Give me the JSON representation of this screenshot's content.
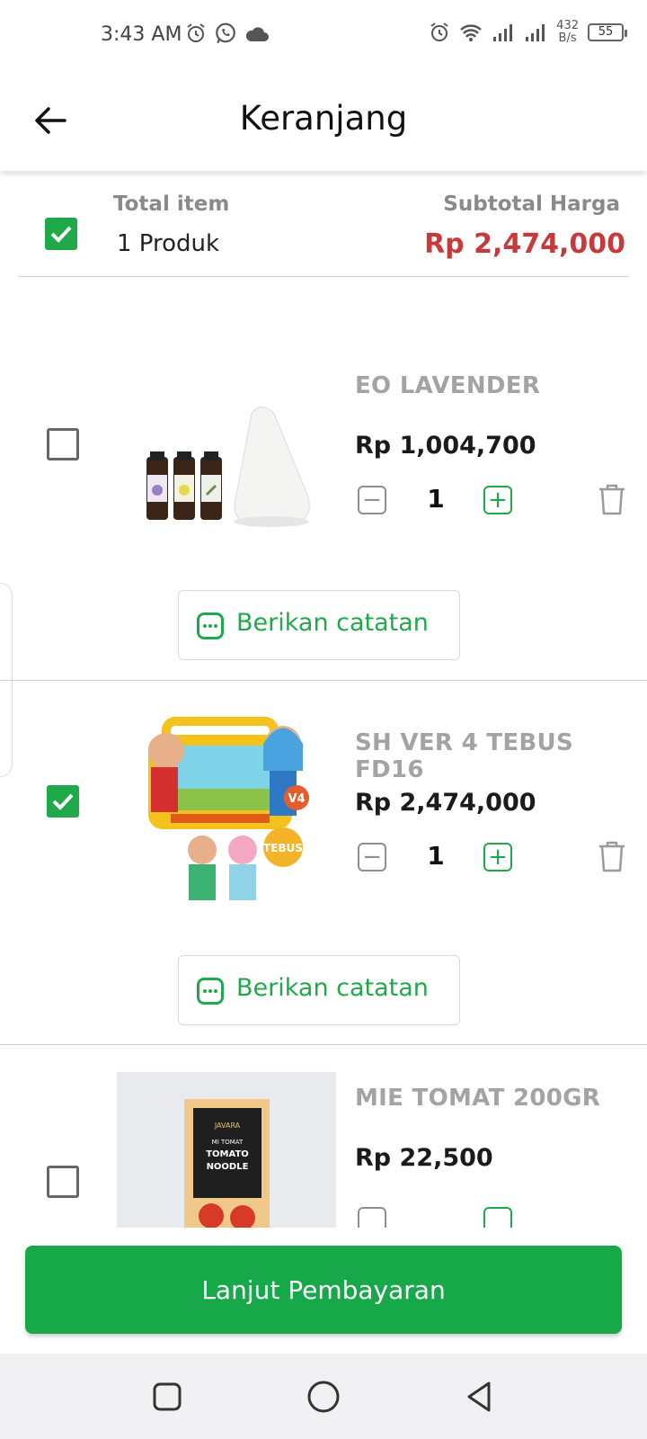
{
  "status_bar": {
    "time": "3:43 AM",
    "speed_value": "432",
    "speed_unit": "B/s",
    "battery": "55",
    "left_icons": [
      "alarm-icon",
      "whatsapp-icon",
      "cloud-icon"
    ],
    "right_icons": [
      "alarm-icon",
      "wifi-icon",
      "signal-icon",
      "signal-icon"
    ]
  },
  "header": {
    "title": "Keranjang",
    "back_icon": "arrow-left-icon"
  },
  "summary": {
    "total_label": "Total item",
    "total_value": "1 Produk",
    "subtotal_label": "Subtotal Harga",
    "subtotal_value": "Rp 2,474,000",
    "select_all_checked": true
  },
  "items": [
    {
      "name": "EO LAVENDER",
      "price": "Rp 1,004,700",
      "quantity": "1",
      "checked": false,
      "note_label": "Berikan catatan"
    },
    {
      "name": "SH VER 4 TEBUS FD16",
      "price": "Rp 2,474,000",
      "quantity": "1",
      "checked": true,
      "note_label": "Berikan catatan",
      "image_badges": [
        "V4",
        "TEBUS"
      ]
    },
    {
      "name": "MIE TOMAT 200GR",
      "price": "Rp 22,500",
      "checked": false,
      "image_text": [
        "JAVARA",
        "MI TOMAT",
        "TOMATO",
        "NOODLE"
      ]
    }
  ],
  "footer": {
    "pay_label": "Lanjut Pembayaran"
  },
  "colors": {
    "accent_green": "#20a94a",
    "price_red": "#c8393b",
    "button_green": "#17a84a"
  }
}
